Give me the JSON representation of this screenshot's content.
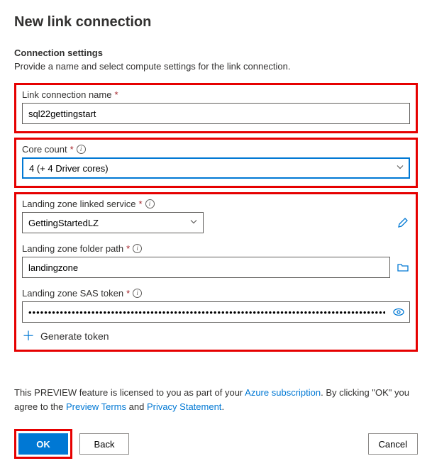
{
  "title": "New link connection",
  "section": {
    "heading": "Connection settings",
    "description": "Provide a name and select compute settings for the link connection."
  },
  "fields": {
    "name": {
      "label": "Link connection name",
      "value": "sql22gettingstart"
    },
    "cores": {
      "label": "Core count",
      "value": "4 (+ 4 Driver cores)"
    },
    "lz_service": {
      "label": "Landing zone linked service",
      "value": "GettingStartedLZ"
    },
    "lz_path": {
      "label": "Landing zone folder path",
      "value": "landingzone"
    },
    "lz_sas": {
      "label": "Landing zone SAS token",
      "value": "••••••••••••••••••••••••••••••••••••••••••••••••••••••••••••••••••••••••••••••••••••••••••••••••••••••••••••••••••••••••••••••••••••••••"
    },
    "generate": "Generate token"
  },
  "preview": {
    "t1": "This PREVIEW feature is licensed to you as part of your ",
    "l1": "Azure subscription",
    "t2": ". By clicking \"OK\" you agree to the ",
    "l2": "Preview Terms",
    "t3": " and ",
    "l3": "Privacy Statement",
    "t4": "."
  },
  "buttons": {
    "ok": "OK",
    "back": "Back",
    "cancel": "Cancel"
  }
}
